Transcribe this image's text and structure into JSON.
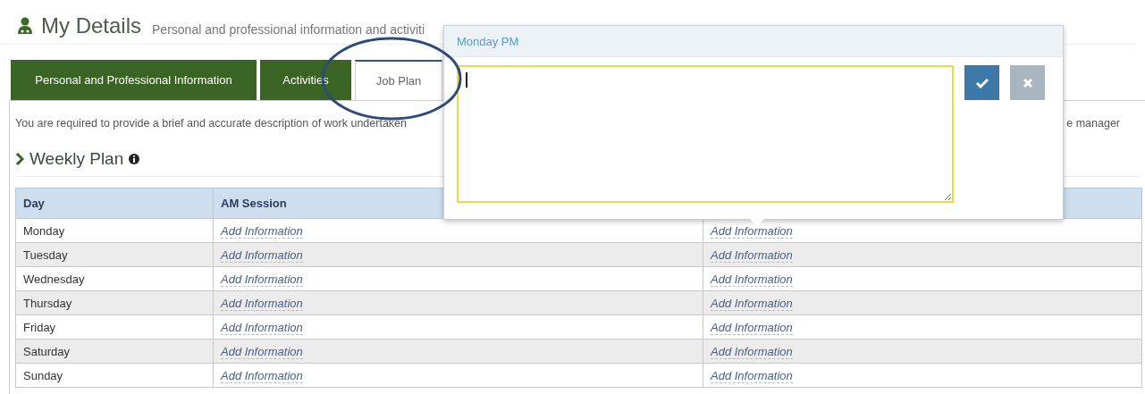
{
  "header": {
    "title": "My Details",
    "subtitle": "Personal and professional information and activiti"
  },
  "tabs": [
    {
      "label": "Personal and Professional Information",
      "selected": false
    },
    {
      "label": "Activities",
      "selected": false
    },
    {
      "label": "Job Plan",
      "selected": true
    }
  ],
  "description": [
    "You are required to provide a brief and accurate description of work undertaken",
    "e manager"
  ],
  "section": {
    "title": "Weekly Plan"
  },
  "table": {
    "columns": [
      "Day",
      "AM Session"
    ],
    "rows": [
      {
        "cells": [
          "Monday",
          "Add Information",
          "Add Information"
        ]
      },
      {
        "cells": [
          "Tuesday",
          "Add Information",
          "Add Information"
        ]
      },
      {
        "cells": [
          "Wednesday",
          "Add Information",
          "Add Information"
        ]
      },
      {
        "cells": [
          "Thursday",
          "Add Information",
          "Add Information"
        ]
      },
      {
        "cells": [
          "Friday",
          "Add Information",
          "Add Information"
        ]
      },
      {
        "cells": [
          "Saturday",
          "Add Information",
          "Add Information"
        ]
      },
      {
        "cells": [
          "Sunday",
          "Add Information",
          "Add Information"
        ]
      }
    ]
  },
  "popover": {
    "title": "Monday PM",
    "focused": true
  }
}
